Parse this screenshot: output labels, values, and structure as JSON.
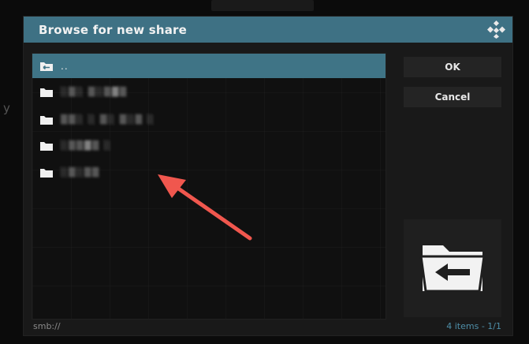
{
  "dialog": {
    "title": "Browse for new share",
    "logo_icon": "kodi-logo-icon"
  },
  "list": {
    "items": [
      {
        "label": "..",
        "icon": "folder-back-icon",
        "selected": true
      },
      {
        "label": "░▒░ ▒░▒▓▒",
        "icon": "folder-icon",
        "redacted": true
      },
      {
        "label": "▒▒░ ░ ▒░ ▒░▒ ░",
        "icon": "folder-icon",
        "redacted": true
      },
      {
        "label": "░▒▒▓▒ ░",
        "icon": "folder-icon",
        "redacted": true
      },
      {
        "label": "░▒░▒▒",
        "icon": "folder-icon",
        "redacted": true
      }
    ]
  },
  "buttons": {
    "ok_label": "OK",
    "cancel_label": "Cancel"
  },
  "preview": {
    "icon": "folder-back-large-icon"
  },
  "footer": {
    "path": "smb://",
    "count": "4 items - 1/1"
  },
  "annotation": {
    "icon": "red-arrow-icon",
    "color": "#f0574e"
  },
  "colors": {
    "accent": "#3e7184",
    "selected_row": "#3f7486",
    "footer_count": "#4e8ea8"
  }
}
